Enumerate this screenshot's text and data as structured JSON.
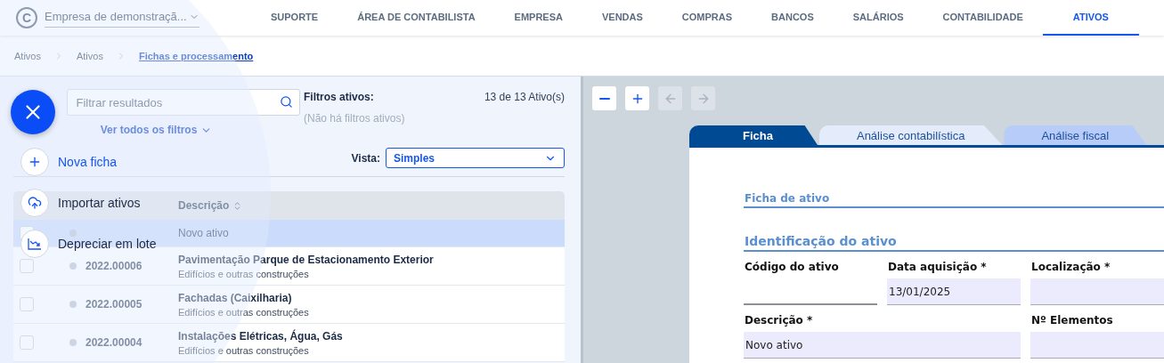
{
  "header": {
    "logo": "C",
    "company": "Empresa de demonstraçã...",
    "nav": [
      {
        "label": "SUPORTE",
        "selected": false
      },
      {
        "label": "ÁREA DE CONTABILISTA",
        "selected": false
      },
      {
        "label": "EMPRESA",
        "selected": false
      },
      {
        "label": "VENDAS",
        "selected": false
      },
      {
        "label": "COMPRAS",
        "selected": false
      },
      {
        "label": "BANCOS",
        "selected": false
      },
      {
        "label": "SALÁRIOS",
        "selected": false
      },
      {
        "label": "CONTABILIDADE",
        "selected": false
      },
      {
        "label": "ATIVOS",
        "selected": true
      }
    ]
  },
  "breadcrumb": [
    "Ativos",
    "Ativos",
    "Fichas e processamento"
  ],
  "list_panel": {
    "search_placeholder": "Filtrar resultados",
    "filters_label": "Filtros ativos:",
    "filters_note": "(Não há filtros ativos)",
    "count": "13 de 13 Ativo(s)",
    "all_filters_link": "Ver todos os filtros",
    "view_label": "Vista:",
    "view_value": "Simples",
    "columns": [
      "Descrição"
    ],
    "rows": [
      {
        "description": "Novo ativo",
        "selected": true,
        "checked": false
      },
      {
        "code": "2022.00006",
        "description": "Pavimentação Parque de Estacionamento Exterior",
        "category": "Edifícios e outras construções",
        "selected": false,
        "checked": false
      },
      {
        "code": "2022.00005",
        "description": "Fachadas (Caixilharia)",
        "category": "Edifícios e outras construções",
        "selected": false,
        "checked": false
      },
      {
        "code": "2022.00004",
        "description": "Instalações Elétricas, Água, Gás",
        "category": "Edifícios e outras construções",
        "selected": false,
        "checked": false
      }
    ]
  },
  "fab": {
    "actions": [
      {
        "kind": "add",
        "label": "Nova ficha",
        "highlighted": true
      },
      {
        "kind": "import",
        "label": "Importar ativos",
        "highlighted": false
      },
      {
        "kind": "depreciate",
        "label": "Depreciar em lote",
        "highlighted": false
      }
    ]
  },
  "viewer": {
    "toolbar": [
      {
        "kind": "zoom-out",
        "disabled": false
      },
      {
        "kind": "zoom-in",
        "disabled": false
      },
      {
        "kind": "back",
        "disabled": true
      },
      {
        "kind": "forward",
        "disabled": true
      }
    ],
    "tabs": [
      {
        "label": "Ficha",
        "selected": true,
        "color": "#004a94"
      },
      {
        "label": "Análise contabilística",
        "selected": false,
        "color": "#e4ecfc"
      },
      {
        "label": "Análise fiscal",
        "selected": false,
        "color": "#b7ccf9"
      }
    ],
    "form": {
      "title": "Ficha de ativo",
      "section": "Identificação do ativo",
      "fields": [
        {
          "label": "Código do ativo",
          "readonly": true,
          "wide": false
        },
        {
          "label": "Data aquisição *",
          "value": "13/01/2025",
          "readonly": false,
          "wide": false
        },
        {
          "label": "Localização *",
          "readonly": false,
          "wide": false
        },
        {
          "label": "Descrição *",
          "value": "Novo ativo",
          "readonly": false,
          "wide": true
        },
        {
          "label": "Nº Elementos",
          "readonly": false,
          "wide": false
        }
      ]
    }
  }
}
